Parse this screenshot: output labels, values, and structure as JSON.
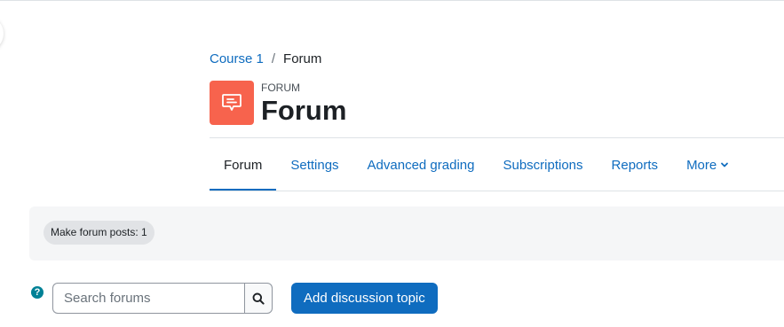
{
  "breadcrumb": {
    "items": [
      {
        "label": "Course 1"
      },
      {
        "label": "Forum"
      }
    ],
    "separator": "/"
  },
  "header": {
    "activity_type": "FORUM",
    "title": "Forum",
    "icon": "forum-speech-bubble-icon",
    "icon_bg_color": "#f7634d"
  },
  "nav": {
    "tabs": [
      {
        "label": "Forum",
        "active": true
      },
      {
        "label": "Settings"
      },
      {
        "label": "Advanced grading"
      },
      {
        "label": "Subscriptions"
      },
      {
        "label": "Reports"
      },
      {
        "label": "More"
      }
    ],
    "more_icon": "chevron-down-icon"
  },
  "completion": {
    "badge": "Make forum posts: 1"
  },
  "search": {
    "help_icon": "?",
    "placeholder": "Search forums",
    "value": "",
    "button_icon": "search-icon"
  },
  "actions": {
    "add_discussion_label": "Add discussion topic"
  },
  "colors": {
    "accent": "#0f6cbf",
    "help": "#008196"
  }
}
